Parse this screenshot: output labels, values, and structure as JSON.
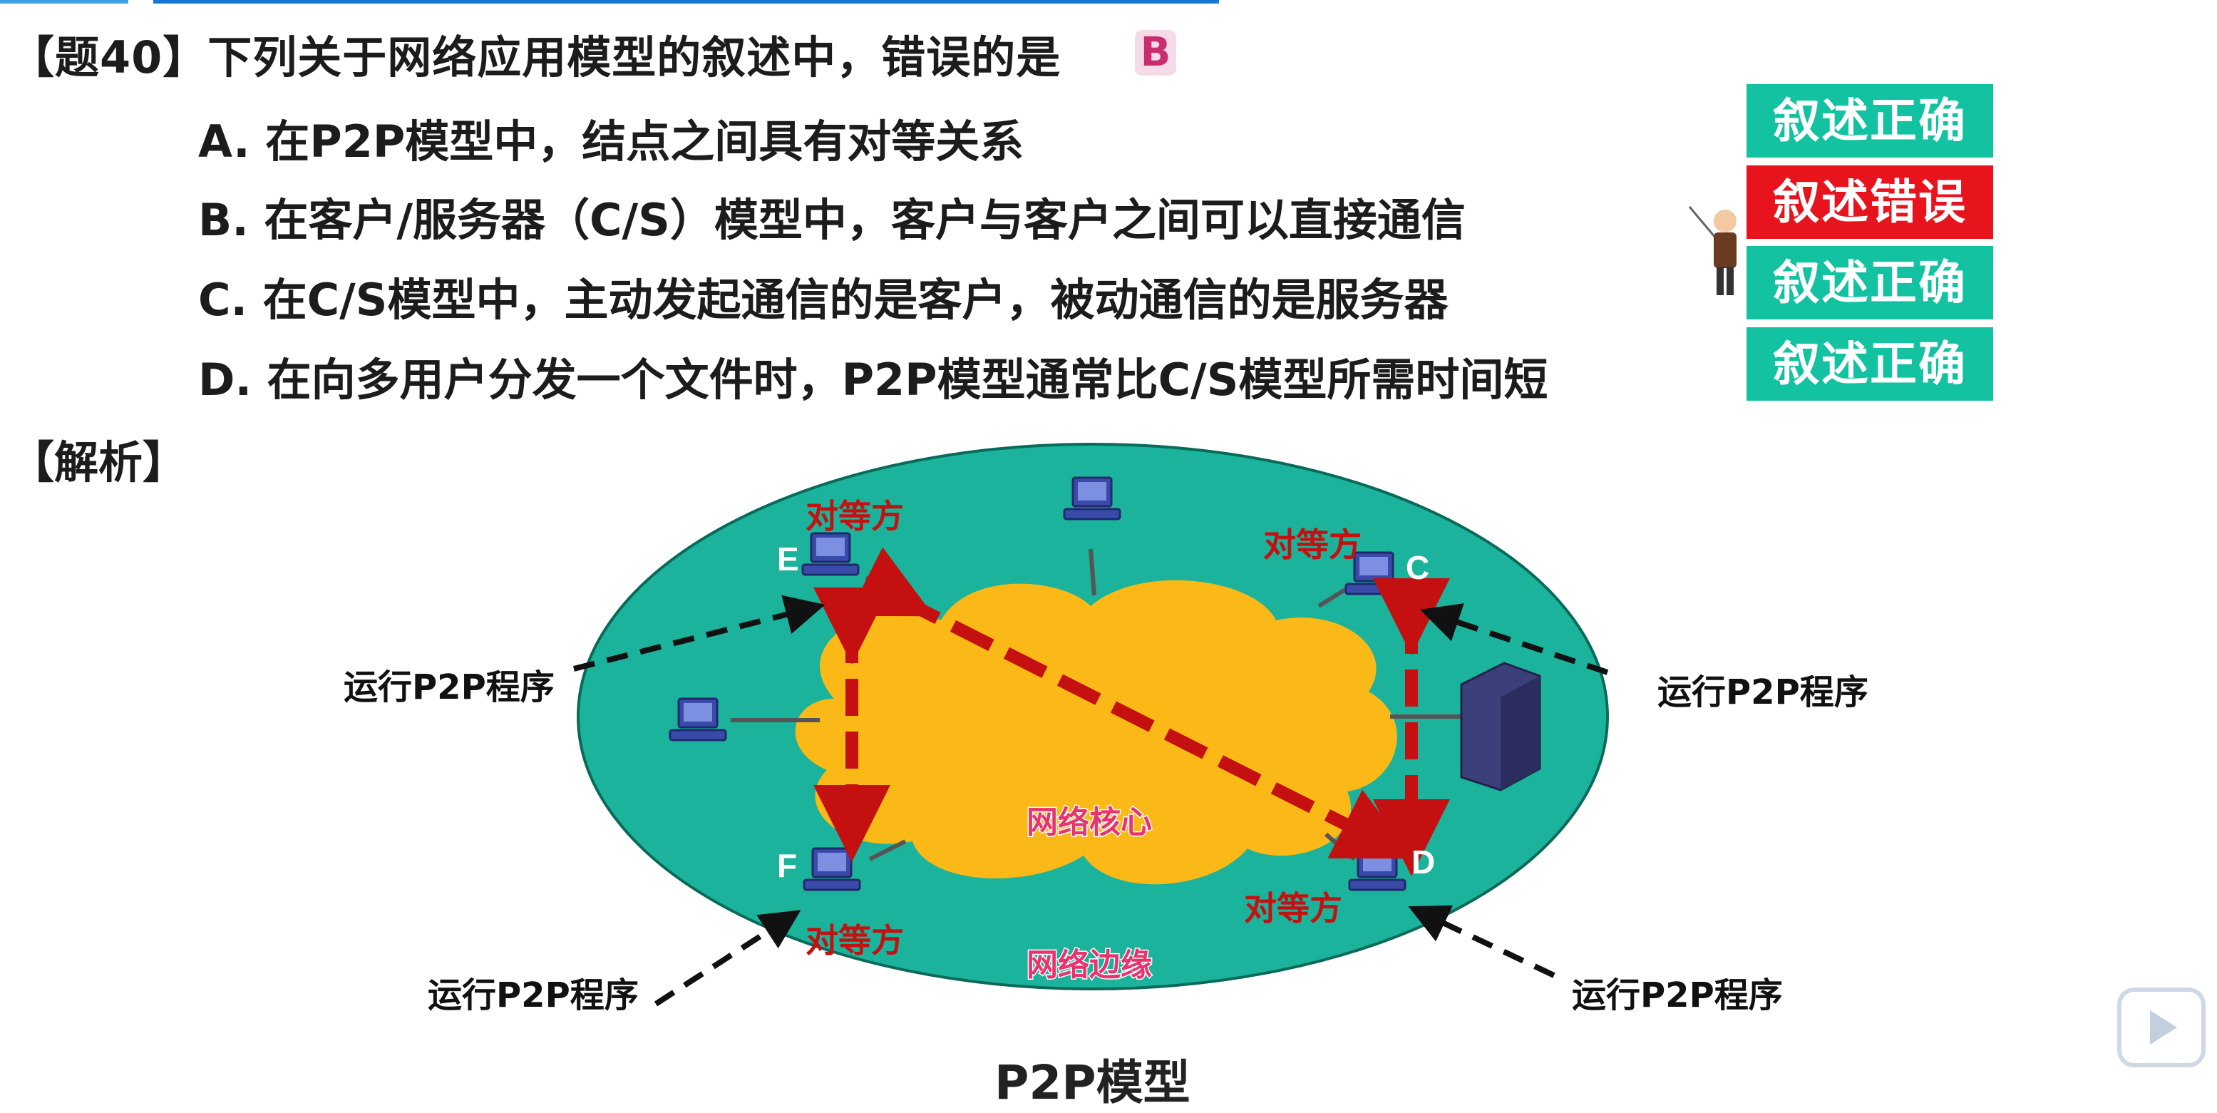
{
  "question": {
    "title": "【题40】下列关于网络应用模型的叙述中，错误的是",
    "answer": "B",
    "options": [
      {
        "text": "A. 在P2P模型中，结点之间具有对等关系",
        "verdict": "叙述正确"
      },
      {
        "text": "B. 在客户/服务器（C/S）模型中，客户与客户之间可以直接通信",
        "verdict": "叙述错误"
      },
      {
        "text": "C. 在C/S模型中，主动发起通信的是客户，被动通信的是服务器",
        "verdict": "叙述正确"
      },
      {
        "text": "D. 在向多用户分发一个文件时，P2P模型通常比C/S模型所需时间短",
        "verdict": "叙述正确"
      }
    ]
  },
  "analysis_label": "【解析】",
  "diagram": {
    "nodes": {
      "e": "E",
      "c": "C",
      "f": "F",
      "d": "D"
    },
    "peer_label": "对等方",
    "run_label": "运行P2P程序",
    "core_label": "网络核心",
    "edge_label": "网络边缘",
    "caption": "P2P模型"
  },
  "colors": {
    "ellipse": "#1bb39b",
    "cloud": "#fbb917",
    "arrow": "#c41010",
    "correct": "#13c2a1",
    "wrong": "#e7131d"
  }
}
